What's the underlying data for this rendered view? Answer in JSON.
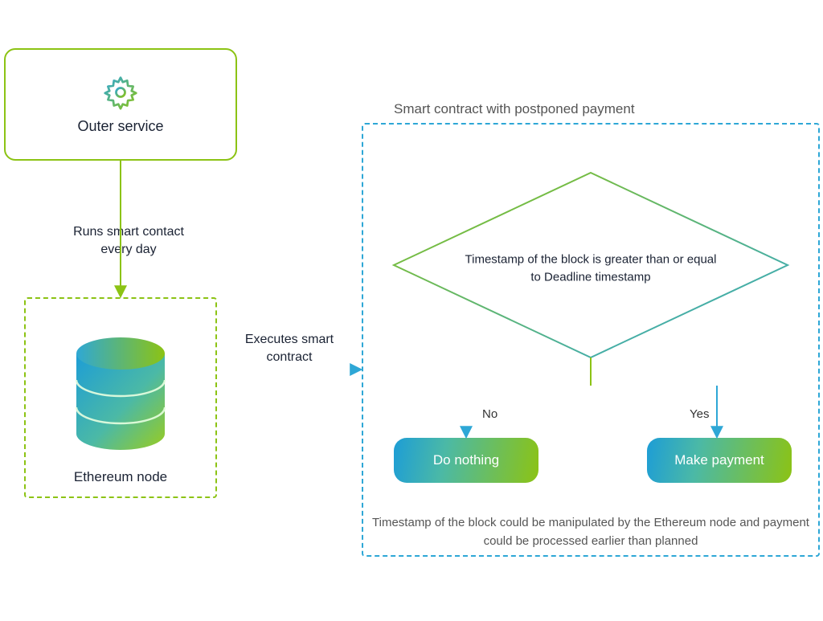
{
  "outer_service": {
    "label": "Outer service"
  },
  "run_label": "Runs smart contact every day",
  "eth_node": {
    "label": "Ethereum node"
  },
  "executes_label": "Executes smart contract",
  "smart_contract": {
    "title": "Smart contract with postponed payment",
    "decision": "Timestamp of the block is greater than or equal to Deadline timestamp",
    "no_label": "No",
    "yes_label": "Yes",
    "do_nothing": "Do nothing",
    "make_payment": "Make payment",
    "risk": "Timestamp of the block could be manipulated by the Ethereum node and payment could be processed earlier than planned"
  },
  "colors": {
    "green": "#8cc314",
    "blue": "#2ea7d6",
    "teal": "#2fb4a6"
  }
}
